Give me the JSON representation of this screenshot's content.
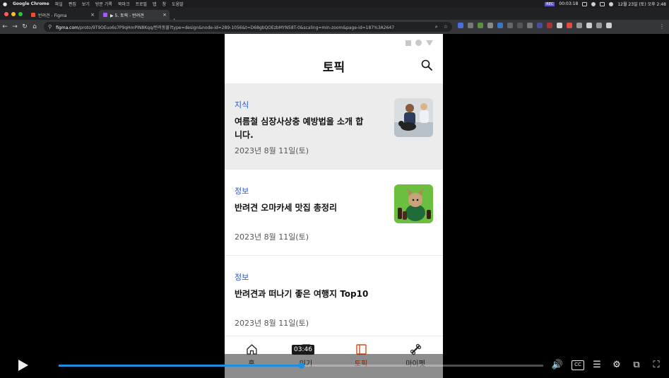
{
  "menubar": {
    "app_name": "Google Chrome",
    "menus": [
      "파일",
      "편집",
      "보기",
      "방문 기록",
      "북마크",
      "프로필",
      "탭",
      "창",
      "도움말"
    ],
    "rec_label": "REC",
    "timer": "00:03:18",
    "clock": "12월 23일 (토) 오후 2:48"
  },
  "tabs": [
    {
      "label": "반려견 - Figma",
      "active": false
    },
    {
      "label": "▶ 5. 토픽 - 반려견",
      "active": true
    }
  ],
  "toolbar": {
    "url_domain": "figma.com",
    "url_rest": "/proto/9T9OEuo6s7P9qHmPIN8Kqq/반려동물?type=design&node-id=289-1056&t=D68gbQOEzbMYN58T-0&scaling=min-zoom&page-id=187%3A2647"
  },
  "app": {
    "title": "토픽",
    "cards": [
      {
        "category": "지식",
        "title": "여름철 심장사상충 예방법을 소개 합니다.",
        "date": "2023년 8월 11일(토)",
        "highlighted": true,
        "thumb": "vet-dog-photo"
      },
      {
        "category": "정보",
        "title": "반려견 오마카세 맛집 총정리",
        "date": "2023년 8월 11일(토)",
        "highlighted": false,
        "thumb": "bulldog-green-photo"
      },
      {
        "category": "정보",
        "title": "반려견과 떠나기 좋은 여행지 Top10",
        "date": "2023년 8월 11일(토)",
        "highlighted": false,
        "thumb": null
      }
    ],
    "nav": [
      {
        "label": "홈",
        "icon": "home-icon"
      },
      {
        "label": "일기",
        "icon": "diary-icon"
      },
      {
        "label": "토픽",
        "icon": "book-icon",
        "active": true
      },
      {
        "label": "마이펫",
        "icon": "bone-icon"
      }
    ],
    "accent_color": "#d9491c",
    "category_color": "#2c55c5"
  },
  "player": {
    "time_tooltip": "03:46",
    "progress": 0.5
  }
}
